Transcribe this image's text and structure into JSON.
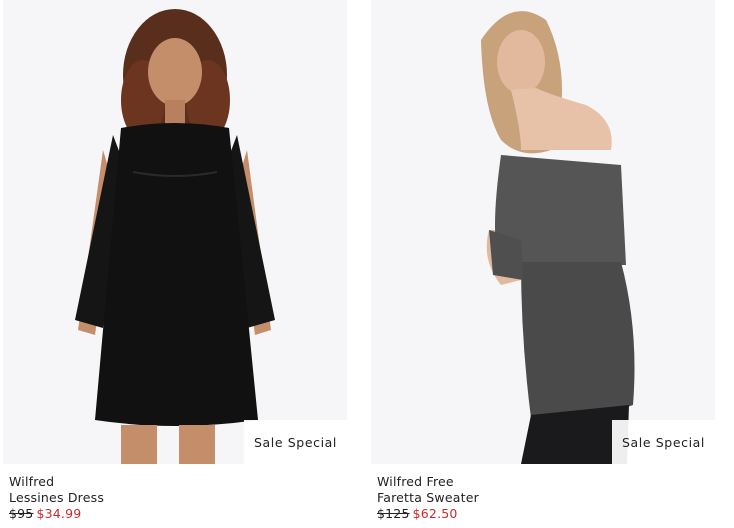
{
  "products": [
    {
      "brand": "Wilfred",
      "name": "Lessines Dress",
      "original_price": "$95",
      "sale_price": "$34.99",
      "badge": "Sale Special"
    },
    {
      "brand": "Wilfred Free",
      "name": "Faretta Sweater",
      "original_price": "$125",
      "sale_price": "$62.50",
      "badge": "Sale Special"
    }
  ],
  "colors": {
    "sale_price": "#cc2b2b",
    "photo_background": "#f6f5f8",
    "dress": "#111111",
    "sweater": "#4a4a4a"
  }
}
